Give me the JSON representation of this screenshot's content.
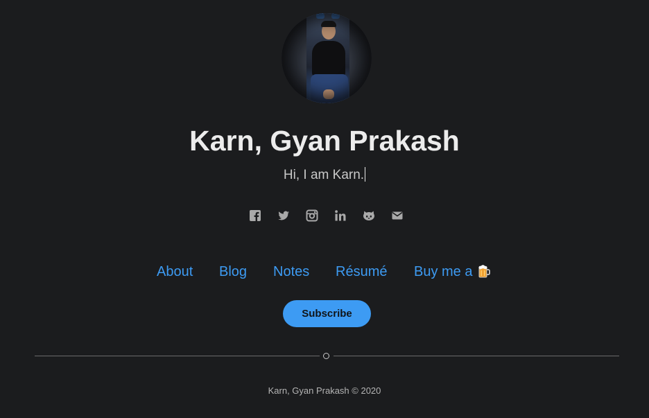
{
  "profile": {
    "name": "Karn, Gyan Prakash",
    "tagline": "Hi, I am Karn."
  },
  "social": [
    {
      "icon": "facebook-icon"
    },
    {
      "icon": "twitter-icon"
    },
    {
      "icon": "instagram-icon"
    },
    {
      "icon": "linkedin-icon"
    },
    {
      "icon": "github-icon"
    },
    {
      "icon": "mail-icon"
    }
  ],
  "nav": {
    "about": "About",
    "blog": "Blog",
    "notes": "Notes",
    "resume": "Résumé",
    "buy_me": "Buy me a",
    "buy_me_icon": "beer-icon"
  },
  "subscribe_label": "Subscribe",
  "footer": {
    "copyright": "Karn, Gyan Prakash © 2020"
  },
  "colors": {
    "background": "#1b1c1e",
    "accent": "#3d9bf3",
    "title": "#ececec",
    "muted": "#b5b5b5"
  }
}
